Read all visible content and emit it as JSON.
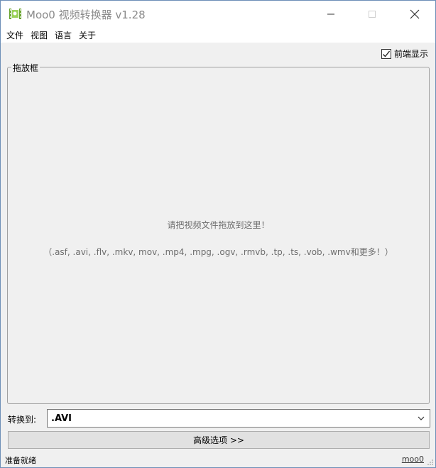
{
  "window": {
    "title": "Moo0 视频转换器 v1.28"
  },
  "menu": {
    "items": [
      "文件",
      "视图",
      "语言",
      "关于"
    ]
  },
  "ontop": {
    "label": "前端显示",
    "checked": true
  },
  "dropframe": {
    "legend": "拖放框",
    "hint_line1": "请把视频文件拖放到这里！",
    "hint_line2": "（.asf, .avi, .flv, .mkv, mov, .mp4, .mpg, .ogv, .rmvb, .tp, .ts, .vob, .wmv和更多！）"
  },
  "convert": {
    "label": "转换到:",
    "selected": ".AVI"
  },
  "advanced": {
    "label": "高级选项 >>"
  },
  "status": {
    "left": "准备就绪",
    "right": "moo0"
  },
  "colors": {
    "accent_green": "#7cbf3a",
    "title_text": "#8a8a8a"
  }
}
